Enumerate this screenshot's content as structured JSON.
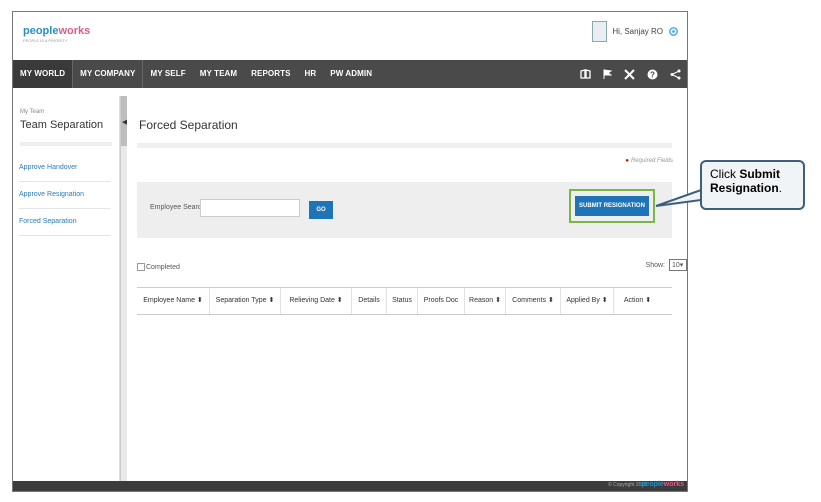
{
  "app": {
    "logo_part1": "people",
    "logo_part2": "works",
    "logo_tagline": "PEOPLE IS A PRIORITY",
    "greeting": "Hi, Sanjay RO"
  },
  "nav": {
    "items": [
      "MY WORLD",
      "MY COMPANY",
      "MY SELF",
      "MY TEAM",
      "REPORTS",
      "HR",
      "PW ADMIN"
    ],
    "icons": [
      "book-icon",
      "flag-icon",
      "tools-icon",
      "help-icon",
      "share-icon"
    ]
  },
  "sidebar": {
    "breadcrumb": "My Team",
    "title": "Team Separation",
    "items": [
      "Approve Handover",
      "Approve Resignation",
      "Forced Separation"
    ]
  },
  "main": {
    "title": "Forced Separation",
    "required_note": "Required Fields",
    "search_label": "Employee Search",
    "search_value": "",
    "go_label": "GO",
    "submit_label": "SUBMIT RESIGNATION",
    "completed_label": "Completed",
    "show_label": "Show:",
    "show_value": "10",
    "columns": [
      "Employee Name ⬍",
      "Separation Type ⬍",
      "Relieving Date ⬍",
      "Details",
      "Status",
      "Proofs Doc",
      "Reason ⬍",
      "Comments ⬍",
      "Applied By ⬍",
      "Action ⬍"
    ]
  },
  "footer": {
    "copyright": "© Copyright 2015",
    "logo_part1": "people",
    "logo_part2": "works"
  },
  "callout": {
    "prefix": "Click ",
    "bold": "Submit Resignation",
    "suffix": "."
  },
  "colors": {
    "nav_bg": "#4a4a4a",
    "primary_button": "#1f73b7",
    "highlight_border": "#7ab648",
    "link": "#2a7ab7"
  }
}
